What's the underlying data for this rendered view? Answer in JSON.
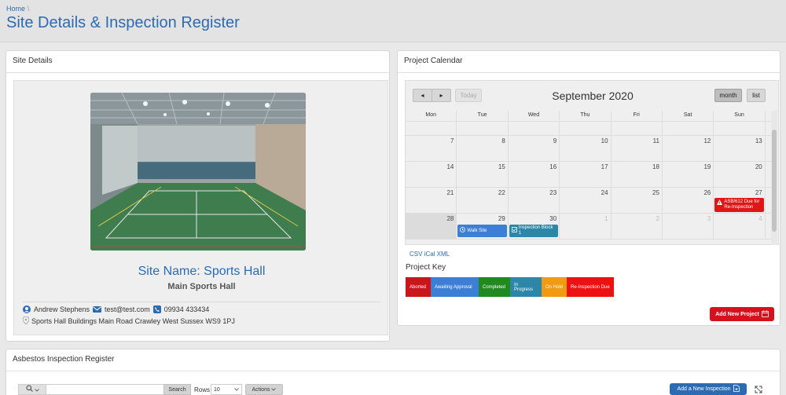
{
  "header": {
    "breadcrumb_home": "Home",
    "breadcrumb_sep": "\\",
    "title": "Site Details & Inspection Register"
  },
  "site": {
    "card_title": "Site Details",
    "name": "Site Name: Sports Hall",
    "subtitle": "Main Sports Hall",
    "contact_name": "Andrew Stephens",
    "email": "test@test.com",
    "phone": "09934 433434",
    "address": "Sports Hall Buildings Main Road Crawley West Sussex WS9 1PJ"
  },
  "calendar": {
    "card_title": "Project Calendar",
    "month_title": "September 2020",
    "prev_icon": "◂",
    "next_icon": "▸",
    "today_label": "Today",
    "view_month": "month",
    "view_list": "list",
    "days_of_week": [
      "Mon",
      "Tue",
      "Wed",
      "Thu",
      "Fri",
      "Sat",
      "Sun"
    ],
    "week2": [
      "7",
      "8",
      "9",
      "10",
      "11",
      "12",
      "13"
    ],
    "week3": [
      "14",
      "15",
      "16",
      "17",
      "18",
      "19",
      "20"
    ],
    "week4": [
      "21",
      "22",
      "23",
      "24",
      "25",
      "26",
      "27"
    ],
    "week5": [
      "28",
      "29",
      "30",
      "1",
      "2",
      "3",
      "4"
    ],
    "events": {
      "asb": "ASB/612 Due for Re-Inspection",
      "walk": "Walk Site",
      "insp": "Inspection Block 1"
    },
    "feed_links": "CSV iCal XML"
  },
  "key": {
    "title": "Project Key",
    "items": [
      {
        "label": "Aborted",
        "color": "#c9161d"
      },
      {
        "label": "Awaiting Approval",
        "color": "#3c7fd6"
      },
      {
        "label": "Completed",
        "color": "#1f8a1f"
      },
      {
        "label": "In Progress",
        "color": "#2b86a8"
      },
      {
        "label": "On Hold",
        "color": "#f39a12"
      },
      {
        "label": "Re-Inspection Due",
        "color": "#ee1111"
      }
    ]
  },
  "add_project_label": "Add New Project",
  "register": {
    "card_title": "Asbestos Inspection Register",
    "search_label": "Search",
    "rows_label": "Rows",
    "rows_value": "10",
    "actions_label": "Actions",
    "add_inspection_label": "Add a New Inspection"
  },
  "colors": {
    "accent_blue": "#2a6bb4",
    "danger_red": "#d6111d"
  }
}
